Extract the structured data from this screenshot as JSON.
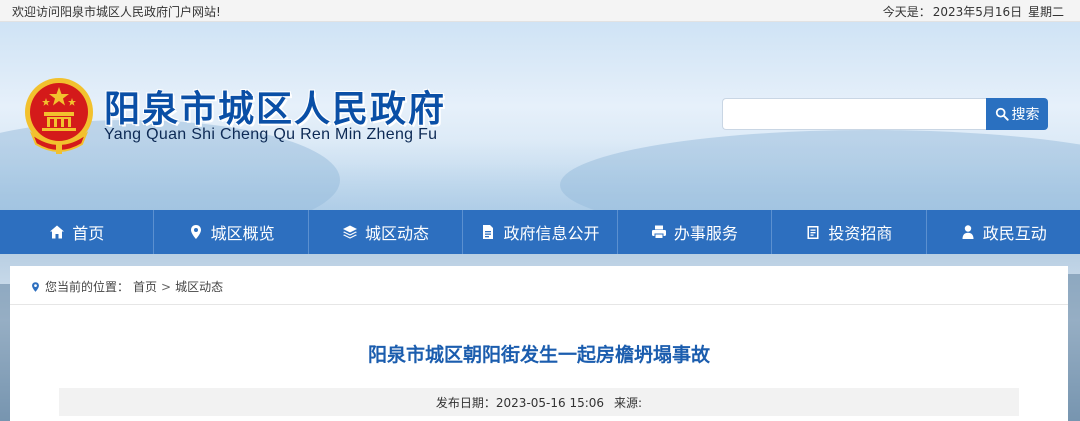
{
  "topbar": {
    "welcome": "欢迎访问阳泉市城区人民政府门户网站!",
    "date_prefix": "今天是：",
    "date": "2023年5月16日",
    "weekday": "星期二"
  },
  "header": {
    "title": "阳泉市城区人民政府",
    "subtitle": "Yang Quan Shi Cheng Qu Ren Min Zheng Fu"
  },
  "search": {
    "placeholder": "",
    "value": "",
    "button_label": "搜索"
  },
  "nav": {
    "items": [
      {
        "label": "首页",
        "icon": "home-icon"
      },
      {
        "label": "城区概览",
        "icon": "location-pin-icon"
      },
      {
        "label": "城区动态",
        "icon": "layers-icon"
      },
      {
        "label": "政府信息公开",
        "icon": "document-icon"
      },
      {
        "label": "办事服务",
        "icon": "printer-icon"
      },
      {
        "label": "投资招商",
        "icon": "clipboard-icon"
      },
      {
        "label": "政民互动",
        "icon": "user-icon"
      }
    ]
  },
  "breadcrumb": {
    "prefix": "您当前的位置：",
    "items": [
      "首页",
      "城区动态"
    ],
    "separator": ">"
  },
  "article": {
    "title": "阳泉市城区朝阳街发生一起房檐坍塌事故",
    "publish_label": "发布日期：",
    "publish_date": "2023-05-16 15:06",
    "source_label": "来源:",
    "source": ""
  },
  "colors": {
    "accent": "#2d6fbf",
    "title_blue": "#0a4fa6",
    "article_title": "#1b5dae",
    "emblem_red": "#d41a1a",
    "emblem_gold": "#f2c12e"
  }
}
